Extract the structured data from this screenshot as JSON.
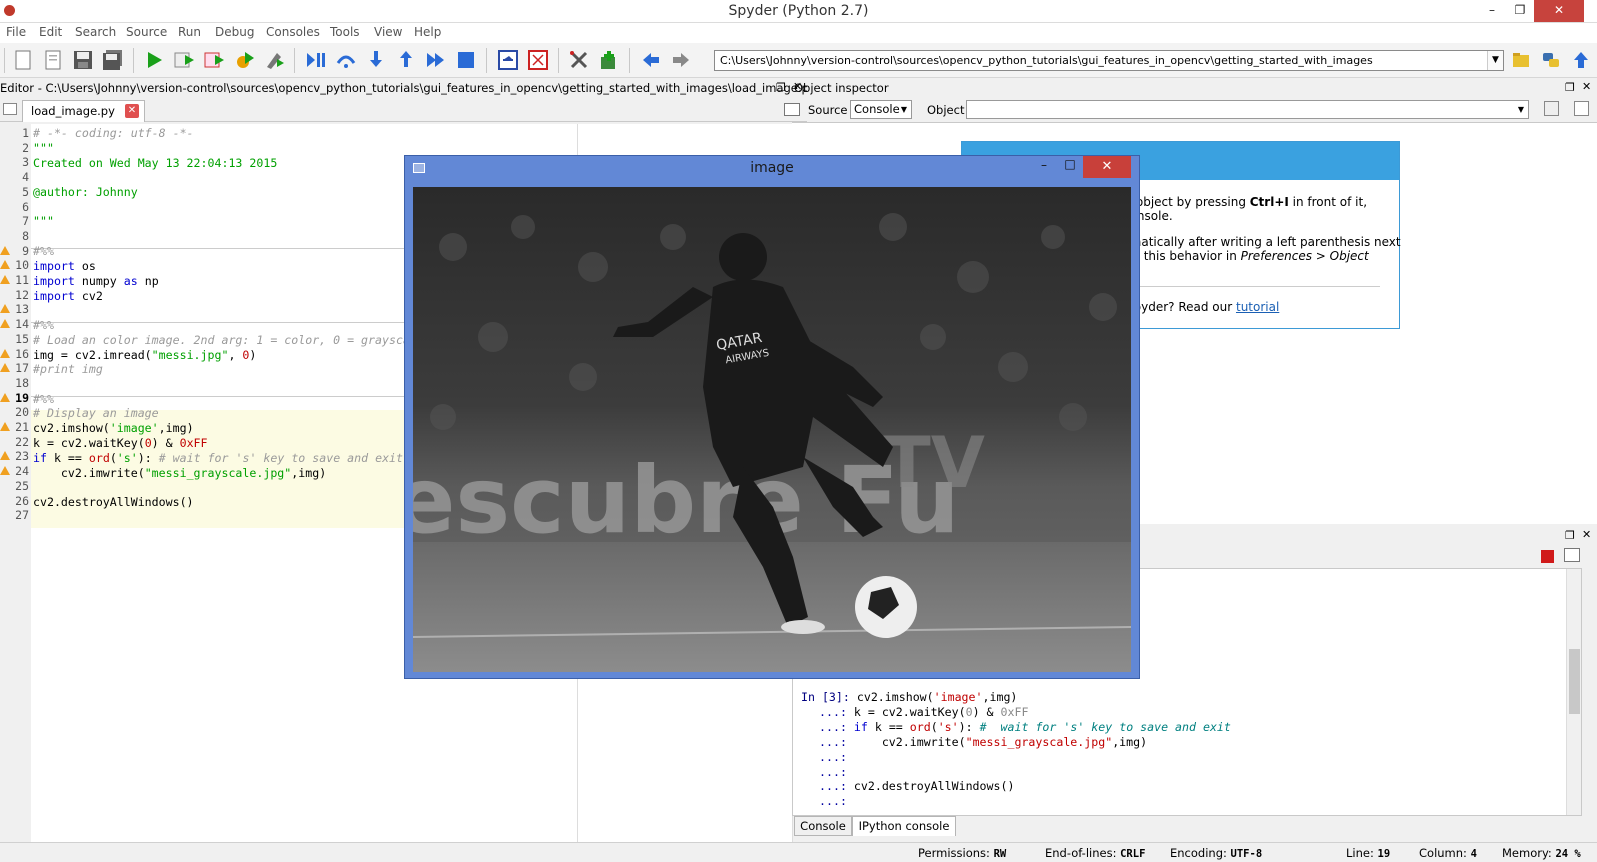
{
  "window": {
    "title": "Spyder (Python 2.7)",
    "minimize": "–",
    "maximize": "❐",
    "close": "✕"
  },
  "menu": [
    "File",
    "Edit",
    "Search",
    "Source",
    "Run",
    "Debug",
    "Consoles",
    "Tools",
    "View",
    "Help"
  ],
  "toolbar": {
    "path": "C:\\Users\\Johnny\\version-control\\sources\\opencv_python_tutorials\\gui_features_in_opencv\\getting_started_with_images"
  },
  "editor": {
    "title": "Editor - C:\\Users\\Johnny\\version-control\\sources\\opencv_python_tutorials\\gui_features_in_opencv\\getting_started_with_images\\load_image.py",
    "tab": "load_image.py",
    "tab_close": "✕",
    "lines": [
      "1",
      "2",
      "3",
      "4",
      "5",
      "6",
      "7",
      "8",
      "9",
      "10",
      "11",
      "12",
      "13",
      "14",
      "15",
      "16",
      "17",
      "18",
      "19",
      "20",
      "21",
      "22",
      "23",
      "24",
      "25",
      "26",
      "27"
    ]
  },
  "image_window": {
    "title": "image",
    "min": "–",
    "max": "□",
    "close": "✕"
  },
  "object_inspector": {
    "title": "Object inspector",
    "source_label": "Source",
    "source_value": "Console",
    "object_label": "Object",
    "object_value": "",
    "help_line1a": "any object by pressing ",
    "help_line1b": "Ctrl+I",
    "help_line1c": " in front of it,",
    "help_line2": "e Console.",
    "help_line3": "utomatically after writing a left parenthesis next",
    "help_line4a": "ivate this behavior in ",
    "help_line4b": "Preferences > Object",
    "help_line5a": "to Spyder? Read our ",
    "help_line5b": "tutorial"
  },
  "console": {
    "dots_top": "...:",
    "in_prompt": "In [3]:",
    "cont": "...:",
    "tabs": [
      "Console",
      "IPython console"
    ]
  },
  "status": {
    "permissions_label": "Permissions:",
    "permissions": "RW",
    "eol_label": "End-of-lines:",
    "eol": "CRLF",
    "encoding_label": "Encoding:",
    "encoding": "UTF-8",
    "line_label": "Line:",
    "line": "19",
    "column_label": "Column:",
    "column": "4",
    "memory_label": "Memory:",
    "memory": "24 %"
  }
}
